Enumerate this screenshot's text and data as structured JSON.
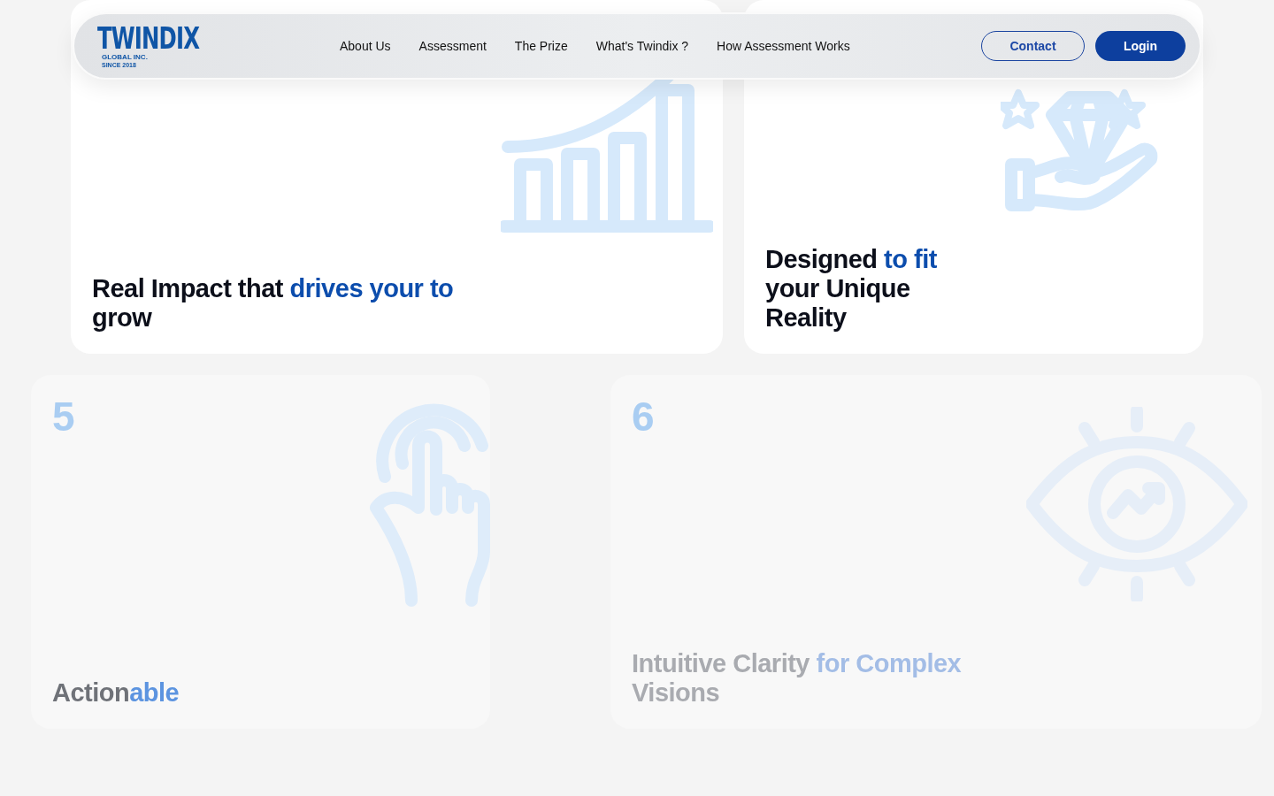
{
  "header": {
    "logo": {
      "name": "TWINDIX",
      "sub": "GLOBAL INC.",
      "since": "SINCE 2018"
    },
    "nav": [
      {
        "label": "About Us"
      },
      {
        "label": "Assessment"
      },
      {
        "label": "The Prize"
      },
      {
        "label": "What's Twindix ?"
      },
      {
        "label": "How Assessment Works"
      }
    ],
    "buttons": [
      {
        "label": "Contact",
        "kind": "outline"
      },
      {
        "label": "Login",
        "kind": "filled"
      }
    ]
  },
  "rows": [
    {
      "cards": [
        {
          "title": [
            {
              "text": "Real Impact ",
              "accent": false
            },
            {
              "text": "that ",
              "accent": false
            },
            {
              "text": "drives your to",
              "accent": true
            },
            {
              "text": " grow",
              "accent": false
            }
          ],
          "dimmed": false
        },
        {
          "title": [
            {
              "text": "Designed ",
              "accent": false
            },
            {
              "text": "to fit",
              "accent": true
            },
            {
              "text": " your ",
              "accent": false
            },
            {
              "text": "Unique",
              "accent": false
            },
            {
              "text": " Reality",
              "accent": false
            }
          ],
          "dimmed": false
        }
      ]
    },
    {
      "cards": [
        {
          "number": "5",
          "title": [
            {
              "text": "Action",
              "accent": false
            },
            {
              "text": "able",
              "accent": true
            }
          ],
          "dimmed": true
        },
        {
          "number": "6",
          "title": [
            {
              "text": "Intuitive Clarity ",
              "accent": false
            },
            {
              "text": "for Complex",
              "accent": true
            },
            {
              "text": " Visions",
              "accent": false
            }
          ],
          "dimmed": true
        }
      ]
    }
  ]
}
